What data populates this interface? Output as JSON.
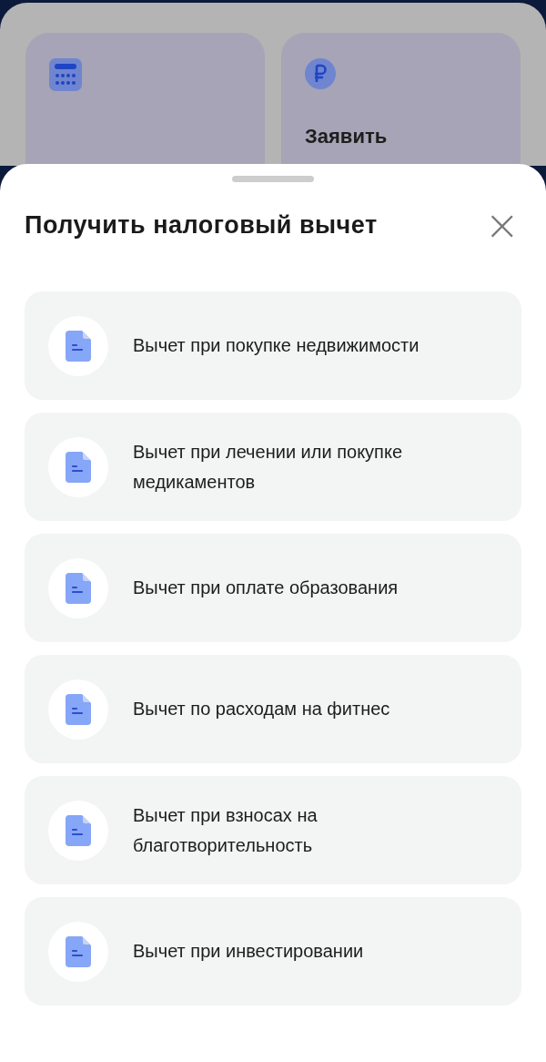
{
  "background_cards": [
    {
      "kind": "calculator"
    },
    {
      "kind": "ruble",
      "title": "Заявить"
    }
  ],
  "sheet": {
    "title": "Получить налоговый вычет",
    "close": "×",
    "items": [
      {
        "label": "Вычет при покупке недвижимости"
      },
      {
        "label": "Вычет при лечении или покупке медикаментов"
      },
      {
        "label": "Вычет при оплате образования"
      },
      {
        "label": "Вычет по расходам на фитнес"
      },
      {
        "label": "Вычет при взносах на благотворительность"
      },
      {
        "label": "Вычет при инвестировании"
      }
    ]
  }
}
